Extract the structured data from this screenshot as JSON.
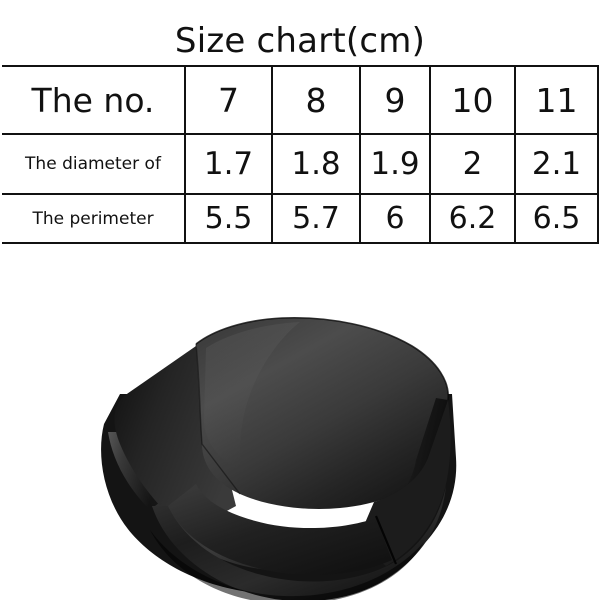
{
  "page": {
    "background_color": "#ffffff",
    "title": "Size chart(cm)"
  },
  "size_chart": {
    "title": "Size chart(cm)",
    "unit": "cm",
    "row_labels": [
      "The no.",
      "The diameter of",
      "The perimeter"
    ],
    "rows": [
      {
        "label": "The no.",
        "values": [
          "7",
          "8",
          "9",
          "10",
          "11"
        ]
      },
      {
        "label": "The diameter of",
        "values": [
          "1.7",
          "1.8",
          "1.9",
          "2",
          "2.1"
        ]
      },
      {
        "label": "The perimeter",
        "values": [
          "5.5",
          "5.7",
          "6",
          "6.2",
          "6.5"
        ]
      }
    ]
  },
  "chart_data": {
    "type": "table",
    "title": "Size chart(cm)",
    "columns": [
      "The no.",
      "7",
      "8",
      "9",
      "10",
      "11"
    ],
    "rows": [
      [
        "The no.",
        "7",
        "8",
        "9",
        "10",
        "11"
      ],
      [
        "The diameter of",
        "1.7",
        "1.8",
        "1.9",
        "2",
        "2.1"
      ],
      [
        "The perimeter",
        "5.5",
        "5.7",
        "6",
        "6.2",
        "6.5"
      ]
    ],
    "series": [
      {
        "name": "The diameter of",
        "categories": [
          "7",
          "8",
          "9",
          "10",
          "11"
        ],
        "values": [
          1.7,
          1.8,
          1.9,
          2,
          2.1
        ]
      },
      {
        "name": "The perimeter",
        "categories": [
          "7",
          "8",
          "9",
          "10",
          "11"
        ],
        "values": [
          5.5,
          5.7,
          6,
          6.2,
          6.5
        ]
      }
    ],
    "xlabel": "The no.",
    "ylabel": "cm"
  },
  "product": {
    "name": "black-signet-ring",
    "colors": {
      "body_dark": "#131313",
      "body_mid": "#2a2a2a",
      "body_light": "#4a4a4a",
      "face_light": "#4e4e4e",
      "face_dark": "#1b1b1b",
      "outline": "#0b0b0b",
      "inner_shadow": "#0d0d0d",
      "background": "#ffffff"
    }
  }
}
